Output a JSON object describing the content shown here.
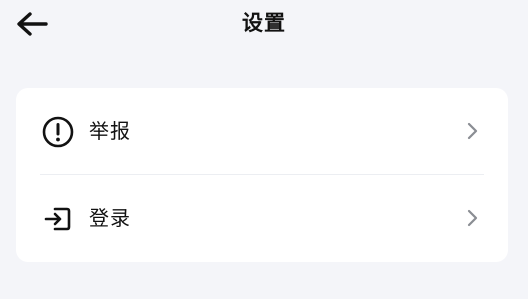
{
  "header": {
    "title": "设置",
    "back_icon": "arrow-left-icon"
  },
  "settings": {
    "items": [
      {
        "label": "举报",
        "icon": "alert-circle-icon",
        "chevron": "chevron-right-icon"
      },
      {
        "label": "登录",
        "icon": "login-icon",
        "chevron": "chevron-right-icon"
      }
    ]
  },
  "colors": {
    "background": "#f4f5f9",
    "card": "#ffffff",
    "text": "#121212",
    "chevron": "#8a8d93",
    "divider": "#eceef2"
  }
}
